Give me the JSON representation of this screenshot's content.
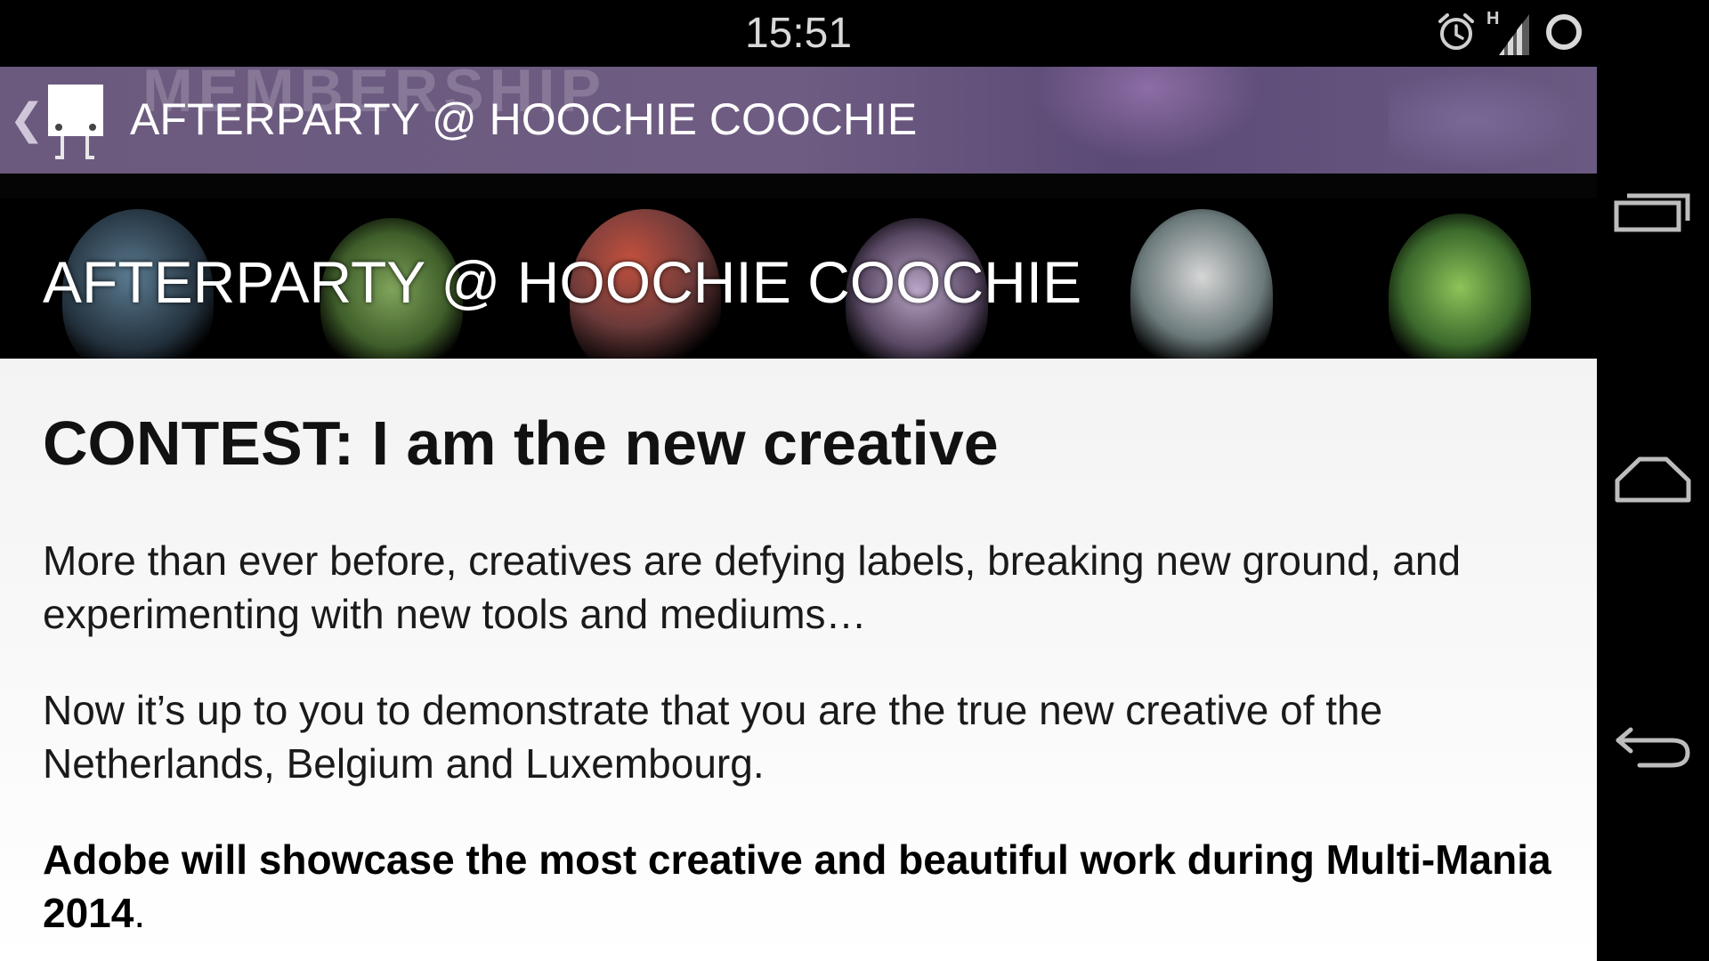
{
  "status_bar": {
    "time": "15:51",
    "network_type": "H",
    "icons": [
      "alarm-icon",
      "signal-icon",
      "sync-icon"
    ]
  },
  "action_bar": {
    "title": "AFTERPARTY @ HOOCHIE COOCHIE",
    "watermark": "MEMBERSHIP",
    "up_icon": "chevron-left-icon",
    "app_icon": "app-logo-icon"
  },
  "banner": {
    "title": "AFTERPARTY @ HOOCHIE COOCHIE"
  },
  "content": {
    "heading": "CONTEST: I am the new creative",
    "paragraphs": [
      "More than ever before, creatives are defying labels, breaking new ground, and experimenting with new tools and mediums…",
      "Now it’s up to you to demonstrate that you are the true new creative of the Netherlands, Belgium and Luxembourg."
    ],
    "bold_paragraph": "Adobe will showcase the most creative and beautiful work during Multi-Mania 2014",
    "bold_paragraph_tail": "."
  },
  "navigation_bar": {
    "buttons": [
      "recent-apps-icon",
      "home-icon",
      "back-icon"
    ]
  },
  "colors": {
    "action_bar": "#6b5a7e",
    "content_bg": "#f5f5f5",
    "system_bar": "#000000"
  }
}
